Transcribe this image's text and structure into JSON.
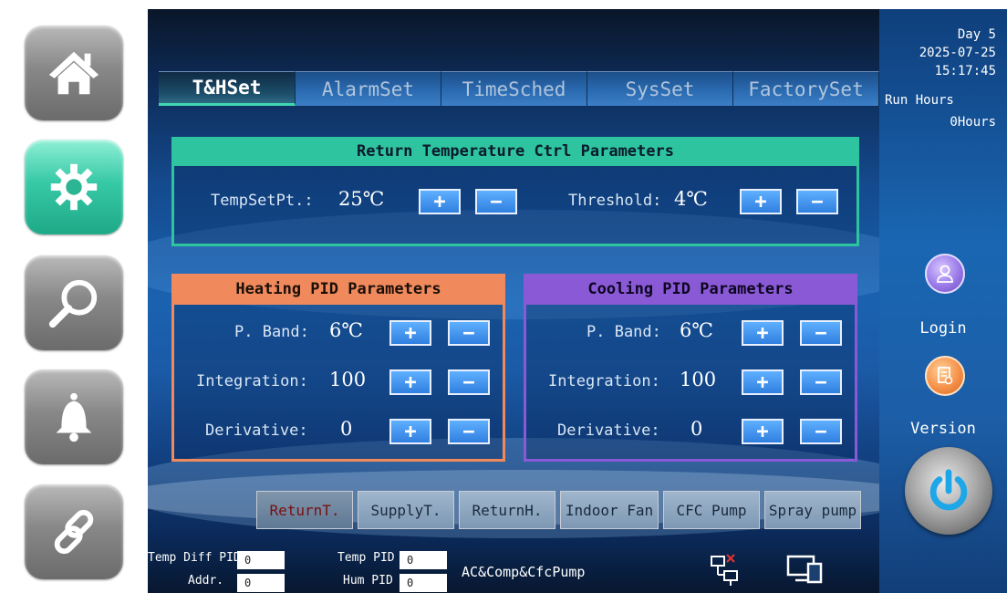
{
  "nav": {
    "items": [
      {
        "icon": "home-icon"
      },
      {
        "icon": "gear-icon",
        "active": true
      },
      {
        "icon": "search-icon"
      },
      {
        "icon": "bell-icon"
      },
      {
        "icon": "link-icon"
      }
    ]
  },
  "tabs": [
    "T&HSet",
    "AlarmSet",
    "TimeSched",
    "SysSet",
    "FactorySet"
  ],
  "active_tab": "T&HSet",
  "return_panel": {
    "title": "Return Temperature Ctrl Parameters",
    "setpoint_label": "TempSetPt.:",
    "setpoint_value": "25℃",
    "threshold_label": "Threshold:",
    "threshold_value": "4℃"
  },
  "heating_panel": {
    "title": "Heating PID Parameters",
    "pband_label": "P. Band:",
    "pband_value": "6℃",
    "integration_label": "Integration:",
    "integration_value": "100",
    "derivative_label": "Derivative:",
    "derivative_value": "0"
  },
  "cooling_panel": {
    "title": "Cooling PID Parameters",
    "pband_label": "P. Band:",
    "pband_value": "6℃",
    "integration_label": "Integration:",
    "integration_value": "100",
    "derivative_label": "Derivative:",
    "derivative_value": "0"
  },
  "plus_label": "+",
  "minus_label": "−",
  "selectors": [
    "ReturnT.",
    "SupplyT.",
    "ReturnH.",
    "Indoor Fan",
    "CFC Pump",
    "Spray pump"
  ],
  "active_selector": "ReturnT.",
  "status": {
    "temp_diff_pid_label": "Temp Diff PID",
    "temp_diff_pid_value": "0",
    "addr_label": "Addr.",
    "addr_value": "0",
    "temp_pid_label": "Temp PID",
    "temp_pid_value": "0",
    "hum_pid_label": "Hum PID",
    "hum_pid_value": "0",
    "mode_text": "AC&Comp&CfcPump"
  },
  "clock": {
    "day": "Day  5",
    "date": "2025-07-25",
    "time": "15:17:45",
    "run_hours_label": "Run Hours",
    "run_hours_value": "0Hours"
  },
  "login_label": "Login",
  "version_label": "Version",
  "colors": {
    "accent_teal": "#2ec4a0",
    "heating_orange": "#f08a5d",
    "cooling_purple": "#8a5ad6"
  }
}
